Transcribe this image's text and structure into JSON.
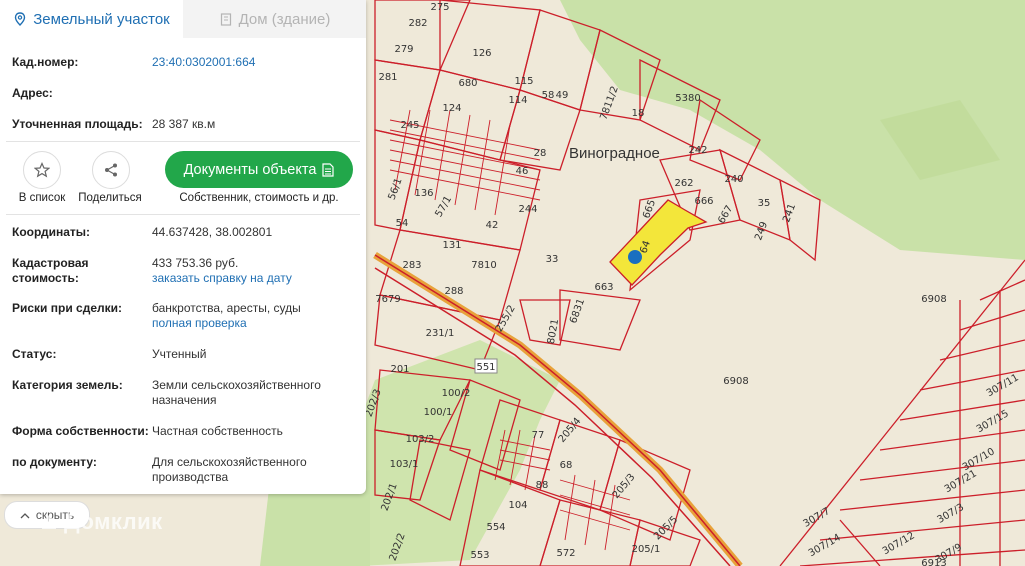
{
  "tabs": [
    {
      "label": "Земельный участок",
      "icon": "location-pin-icon",
      "active": true
    },
    {
      "label": "Дом (здание)",
      "icon": "building-icon",
      "active": false
    }
  ],
  "info": {
    "cadastral_label": "Кад.номер:",
    "cadastral_value": "23:40:0302001:664",
    "address_label": "Адрес:",
    "area_label": "Уточненная площадь:",
    "area_value": "28 387 кв.м"
  },
  "actions": {
    "favorite_label": "В список",
    "share_label": "Поделиться",
    "documents_button": "Документы объекта",
    "documents_sub": "Собственник, стоимость и др."
  },
  "details": {
    "coords_label": "Координаты:",
    "coords_value": "44.637428, 38.002801",
    "cost_label": "Кадастровая стоимость:",
    "cost_value": "433 753.36 руб.",
    "cost_link": "заказать справку на дату",
    "risk_label": "Риски при сделки:",
    "risk_value": "банкротства, аресты, суды",
    "risk_link": "полная проверка",
    "status_label": "Статус:",
    "status_value": "Учтенный",
    "category_label": "Категория земель:",
    "category_value": "Земли сельскохозяйственного назначения",
    "ownership_label": "Форма собственности:",
    "ownership_value": "Частная собственность",
    "by_doc_label": "по документу:",
    "by_doc_value": "Для сельскохозяйственного производства"
  },
  "hide_button": "скрыть",
  "brand": "Домклик",
  "map": {
    "town": "Виноградное",
    "road_badge": "551",
    "plot_labels": [
      "275",
      "282",
      "279",
      "126",
      "281",
      "680",
      "115",
      "58",
      "49",
      "114",
      "124",
      "245",
      "28",
      "7811/2",
      "18",
      "5380",
      "242",
      "46",
      "262",
      "240",
      "666",
      "667",
      "35",
      "241",
      "249",
      "665",
      "64",
      "56/1",
      "136",
      "57/1",
      "54",
      "244",
      "42",
      "131",
      "33",
      "283",
      "7810",
      "663",
      "288",
      "7679",
      "6831",
      "255/2",
      "231/1",
      "8021",
      "6908",
      "6908",
      "201",
      "100/2",
      "202/3",
      "100/1",
      "77",
      "205/4",
      "103/2",
      "68",
      "103/1",
      "88",
      "205/3",
      "202/1",
      "104",
      "554",
      "205/5",
      "572",
      "205/1",
      "553",
      "202/2",
      "307/11",
      "307/15",
      "307/10",
      "307/21",
      "307/3",
      "307/7",
      "307/14",
      "307/9",
      "6913",
      "307/12"
    ],
    "colors": {
      "parcel_line": "#cc1f2a",
      "highway": "#e8a23a",
      "selected": "#f3e63a",
      "marker": "#1a6fc0",
      "forest": "#c7dfa6",
      "field": "#efe9d9"
    }
  }
}
